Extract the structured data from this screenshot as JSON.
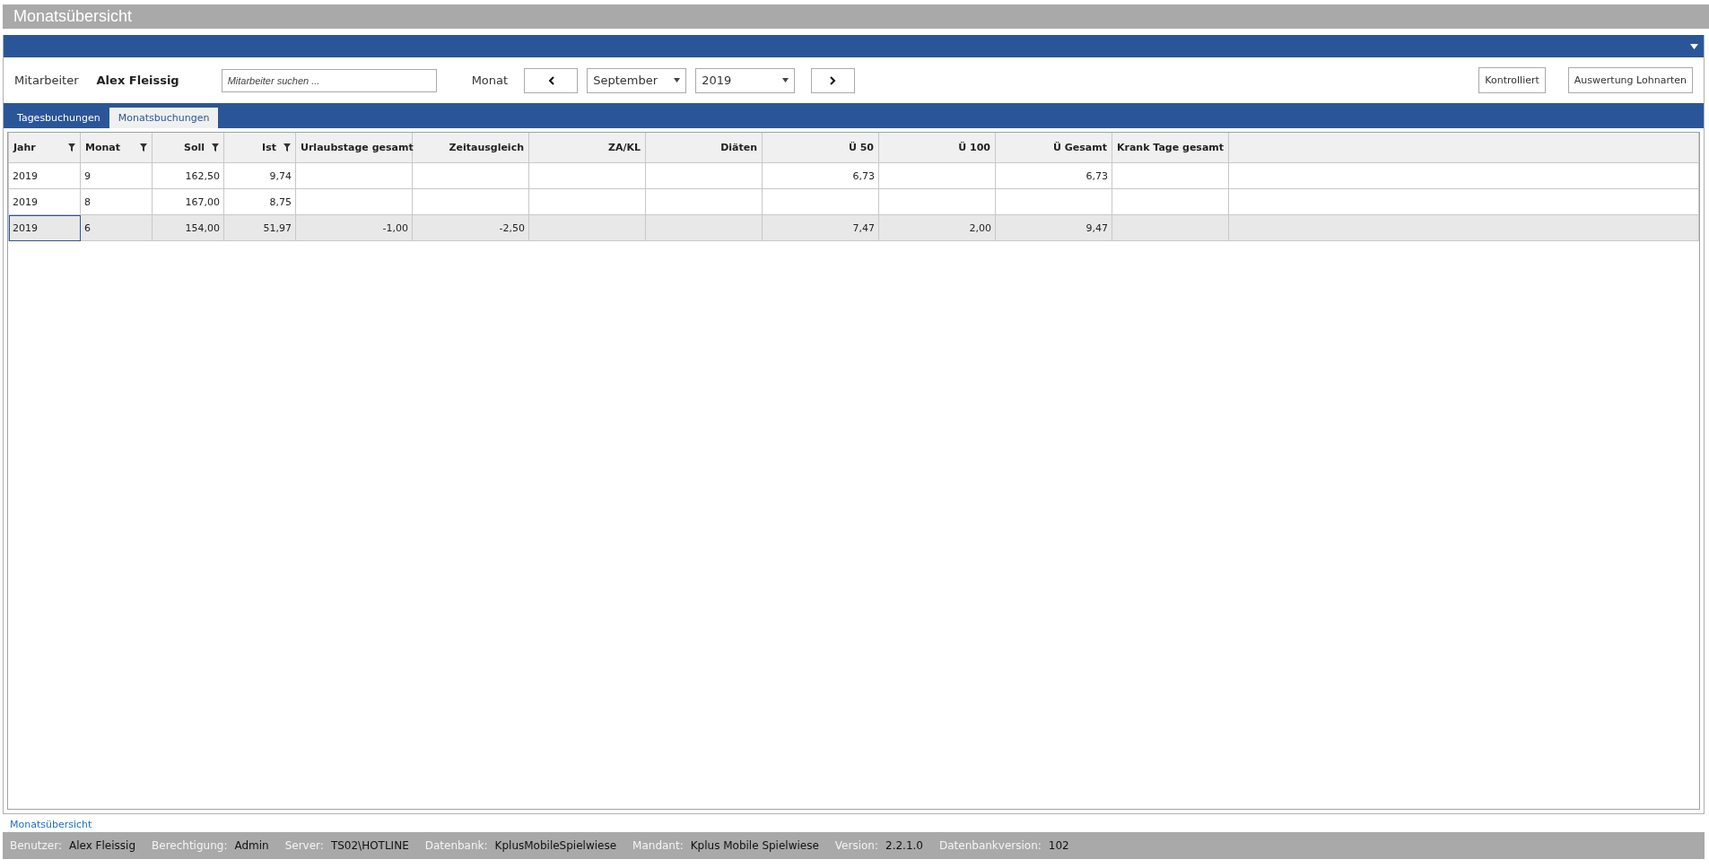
{
  "window": {
    "title": "Monatsübersicht"
  },
  "panel": {
    "collapsed": false
  },
  "toolbar": {
    "employee_label": "Mitarbeiter",
    "employee_name": "Alex Fleissig",
    "search": {
      "placeholder": "Mitarbeiter suchen ..."
    },
    "month_label": "Monat",
    "month": "September",
    "year": "2019",
    "buttons": [
      "Kontrolliert",
      "Auswertung Lohnarten"
    ]
  },
  "tabs": [
    {
      "label": "Tagesbuchungen",
      "selected": false
    },
    {
      "label": "Monatsbuchungen",
      "selected": true
    }
  ],
  "table": {
    "columns": [
      {
        "label": "Jahr",
        "filter": true
      },
      {
        "label": "Monat",
        "filter": true
      },
      {
        "label": "Soll",
        "filter": true
      },
      {
        "label": "Ist",
        "filter": true
      },
      {
        "label": "Urlaubstage gesamt",
        "filter": false
      },
      {
        "label": "Zeitausgleich",
        "filter": false
      },
      {
        "label": "ZA/KL",
        "filter": false
      },
      {
        "label": "Diäten",
        "filter": false
      },
      {
        "label": "Ü 50",
        "filter": false
      },
      {
        "label": "Ü 100",
        "filter": false
      },
      {
        "label": "Ü Gesamt",
        "filter": false
      },
      {
        "label": "Krank Tage gesamt",
        "filter": false
      }
    ],
    "rows": [
      {
        "selected": false,
        "cells": [
          "2019",
          "9",
          "162,50",
          "9,74",
          null,
          null,
          null,
          null,
          "6,73",
          null,
          "6,73",
          null
        ]
      },
      {
        "selected": false,
        "cells": [
          "2019",
          "8",
          "167,00",
          "8,75",
          null,
          null,
          null,
          null,
          null,
          null,
          null,
          null
        ]
      },
      {
        "selected": true,
        "cells": [
          "2019",
          "6",
          "154,00",
          "51,97",
          "-1,00",
          "-2,50",
          null,
          null,
          "7,47",
          "2,00",
          "9,47",
          null
        ]
      }
    ]
  },
  "footer_link": "Monatsübersicht",
  "status_bar": [
    {
      "label": "Benutzer:",
      "value": "Alex Fleissig"
    },
    {
      "label": "Berechtigung:",
      "value": "Admin"
    },
    {
      "label": "Server:",
      "value": "TS02\\HOTLINE"
    },
    {
      "label": "Datenbank:",
      "value": "KplusMobileSpielwiese"
    },
    {
      "label": "Mandant:",
      "value": "Kplus Mobile Spielwiese"
    },
    {
      "label": "Version:",
      "value": "2.2.1.0"
    },
    {
      "label": "Datenbankversion:",
      "value": "102"
    }
  ]
}
